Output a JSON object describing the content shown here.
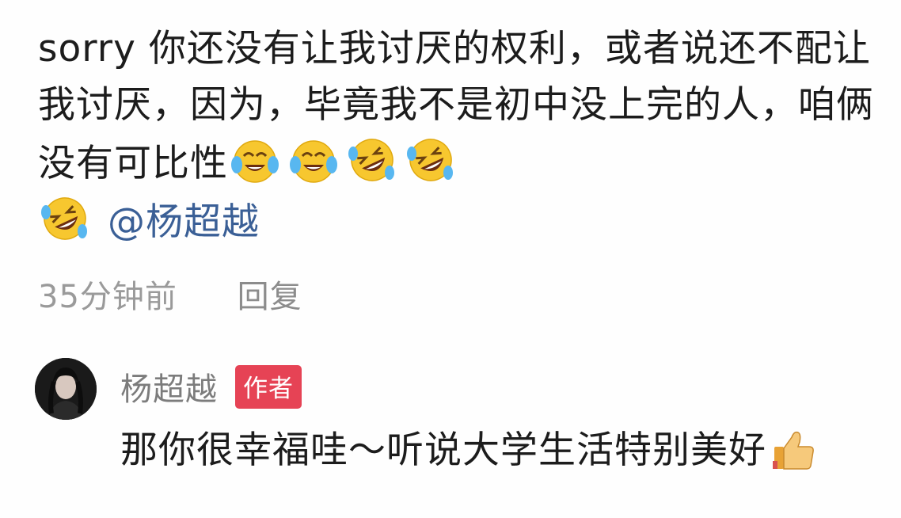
{
  "comment": {
    "text": "sorry 你还没有让我讨厌的权利，或者说还不配让我讨厌，因为，毕竟我不是初中没上完的人，咱俩没有可比性",
    "emojis": [
      "tears-of-joy-icon",
      "tears-of-joy-icon",
      "rolling-laughing-icon",
      "rolling-laughing-icon",
      "rolling-laughing-icon"
    ],
    "mention": "@杨超越",
    "time": "35分钟前",
    "reply_label": "回复"
  },
  "reply": {
    "author": "杨超越",
    "badge": "作者",
    "text": "那你很幸福哇～听说大学生活特别美好",
    "emoji": "thumbs-up-icon"
  }
}
